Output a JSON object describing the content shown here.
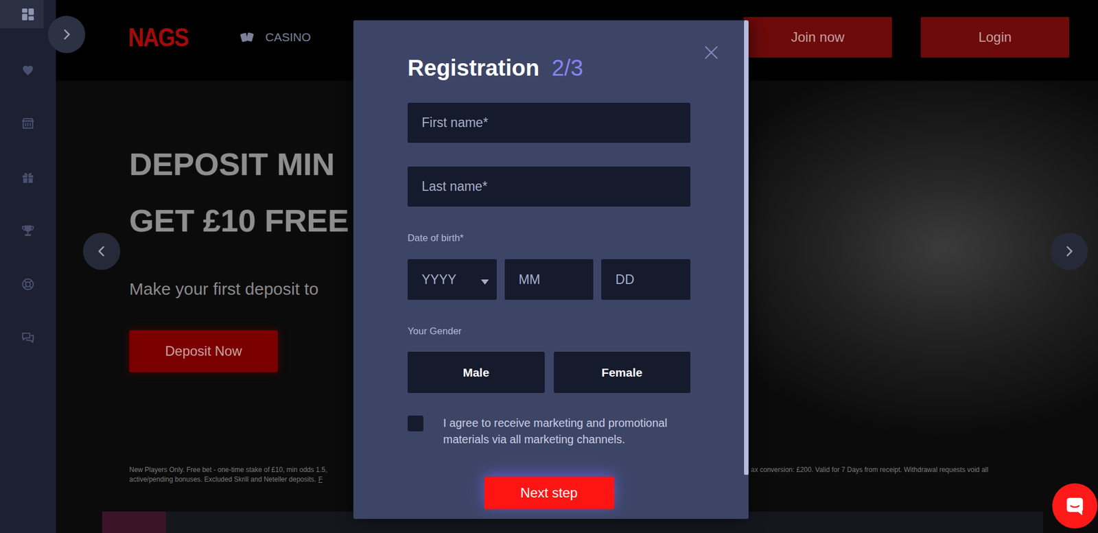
{
  "sidebar": {
    "items": [
      {
        "selected": true
      },
      {
        "selected": false
      },
      {
        "selected": false
      },
      {
        "selected": false
      },
      {
        "selected": false
      },
      {
        "selected": false
      },
      {
        "selected": false
      }
    ]
  },
  "header": {
    "logo": "NAGS",
    "nav": [
      {
        "label": "CASINO"
      }
    ],
    "buttons": [
      {
        "label": "Join now"
      },
      {
        "label": "Login"
      }
    ]
  },
  "hero": {
    "headline": [
      "DEPOSIT MIN",
      "GET £10 FREE"
    ],
    "subtitle": "Make your first deposit to",
    "button": "Deposit Now",
    "terms_left": [
      "New Players Only. Free bet - one-time stake of £10, min odds 1.5,",
      "active/pending bonuses. Excluded Skrill and Neteller deposits."
    ],
    "terms_link": "F",
    "terms_right": [
      "ax conversion: £200. Valid for 7 Days from receipt. Withdrawal requests void all"
    ]
  },
  "modal": {
    "title": "Registration",
    "step": "2/3",
    "fields": [
      {
        "placeholder": "First name*"
      },
      {
        "placeholder": "Last name*"
      }
    ],
    "dob": {
      "label": "Date of birth*",
      "parts": [
        {
          "placeholder": "YYYY",
          "kind": "select"
        },
        {
          "placeholder": "MM",
          "kind": "input"
        },
        {
          "placeholder": "DD",
          "kind": "input"
        }
      ]
    },
    "gender": {
      "label": "Your Gender",
      "options": [
        {
          "label": "Male",
          "selected": false
        },
        {
          "label": "Female",
          "selected": false
        }
      ]
    },
    "marketing": {
      "label": "I agree to receive marketing and promotional materials via all marketing channels.",
      "checked": false
    },
    "submit": "Next step"
  }
}
